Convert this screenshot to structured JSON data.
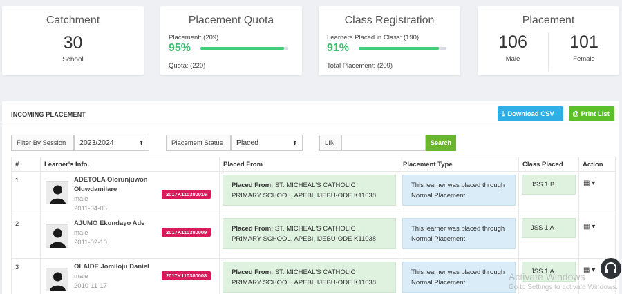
{
  "cards": {
    "catchment": {
      "title": "Catchment",
      "value": "30",
      "label": "School"
    },
    "quota": {
      "title": "Placement Quota",
      "line": "Placement: (209)",
      "pct": "95%",
      "fraction": 0.95,
      "bottom": "Quota: (220)"
    },
    "class_reg": {
      "title": "Class Registration",
      "line": "Learners Placed in Class: (190)",
      "pct": "91%",
      "fraction": 0.91,
      "bottom": "Total Placement: (209)"
    },
    "placement": {
      "title": "Placement",
      "male_value": "106",
      "male_label": "Male",
      "female_value": "101",
      "female_label": "Female"
    }
  },
  "panel": {
    "title": "INCOMING PLACEMENT",
    "download": "Download CSV",
    "print": "Print List"
  },
  "filters": {
    "session_label": "Filter By Session",
    "session_value": "2023/2024",
    "status_label": "Placement Status",
    "status_value": "Placed",
    "lin_label": "LIN",
    "lin_value": "",
    "search": "Search"
  },
  "table": {
    "headers": [
      "#",
      "Learner's Info.",
      "Placed From",
      "Placement Type",
      "Class Placed",
      "Action"
    ],
    "rows": [
      {
        "num": "1",
        "name": "ADETOLA Olorunjuwon Oluwdamilare",
        "gender": "male",
        "dob": "2011-04-05",
        "lin": "2017K110380016",
        "from_label": "Placed From:",
        "from": " ST. MICHEAL'S CATHOLIC PRIMARY SCHOOL, APEBI, IJEBU-ODE K11038",
        "type": "This learner was placed through Normal Placement",
        "class": "JSS 1 B"
      },
      {
        "num": "2",
        "name": "AJUMO Ekundayo Ade",
        "gender": "male",
        "dob": "2011-02-10",
        "lin": "2017K110380009",
        "from_label": "Placed From:",
        "from": " ST. MICHEAL'S CATHOLIC PRIMARY SCHOOL, APEBI, IJEBU-ODE K11038",
        "type": "This learner was placed through Normal Placement",
        "class": "JSS 1 A"
      },
      {
        "num": "3",
        "name": "OLAIDE Jomiloju Daniel",
        "gender": "male",
        "dob": "2010-11-17",
        "lin": "2017K110380008",
        "from_label": "Placed From:",
        "from": " ST. MICHEAL'S CATHOLIC PRIMARY SCHOOL, APEBI, IJEBU-ODE K11038",
        "type": "This learner was placed through Normal Placement",
        "class": "JSS 1 A"
      }
    ]
  },
  "watermark": {
    "line1": "Activate Windows",
    "line2": "Go to Settings to activate Windows."
  }
}
